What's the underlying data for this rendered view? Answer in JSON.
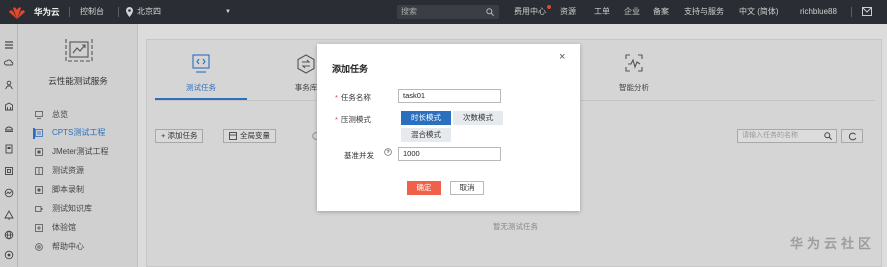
{
  "topbar": {
    "brand": "华为云",
    "console": "控制台",
    "region": "北京四",
    "search_placeholder": "搜索",
    "links": [
      "费用中心",
      "资源",
      "工单",
      "企业",
      "备案",
      "支持与服务",
      "中文 (简体)",
      "richblue88"
    ]
  },
  "sidebar": {
    "service_title": "云性能测试服务",
    "items": [
      {
        "label": "总览",
        "icon": "overview-icon"
      },
      {
        "label": "CPTS测试工程",
        "icon": "project-icon"
      },
      {
        "label": "JMeter测试工程",
        "icon": "jmeter-icon"
      },
      {
        "label": "测试资源",
        "icon": "resource-icon"
      },
      {
        "label": "脚本录制",
        "icon": "record-icon"
      },
      {
        "label": "测试知识库",
        "icon": "knowledge-icon"
      },
      {
        "label": "体验馆",
        "icon": "experience-icon"
      },
      {
        "label": "帮助中心",
        "icon": "help-center-icon"
      }
    ],
    "active_index": 1
  },
  "main": {
    "tabs": [
      {
        "label": "测试任务",
        "icon": "code-icon"
      },
      {
        "label": "事务库",
        "icon": "transaction-icon"
      },
      {
        "label": "智能分析",
        "icon": "analysis-icon"
      }
    ],
    "active_tab": 0,
    "buttons": {
      "add_task": "+ 添加任务",
      "global_vars": "全局变量"
    },
    "search_placeholder": "请输入任务的名称",
    "refresh": "C",
    "empty_text": "暂无测试任务"
  },
  "dialog": {
    "title": "添加任务",
    "close": "×",
    "task_name_label": "任务名称",
    "task_name_value": "task01",
    "mode_label": "压测模式",
    "modes": [
      "时长模式",
      "次数模式",
      "混合模式"
    ],
    "selected_mode": "时长模式",
    "concurrency_label": "基准并发",
    "concurrency_value": "1000",
    "ok": "确定",
    "cancel": "取消"
  },
  "watermark": "华为云社区",
  "colors": {
    "accent": "#2b6fbf",
    "primary_action": "#f06149",
    "required": "#e03c3c",
    "topbar_bg": "#2a2d33"
  }
}
